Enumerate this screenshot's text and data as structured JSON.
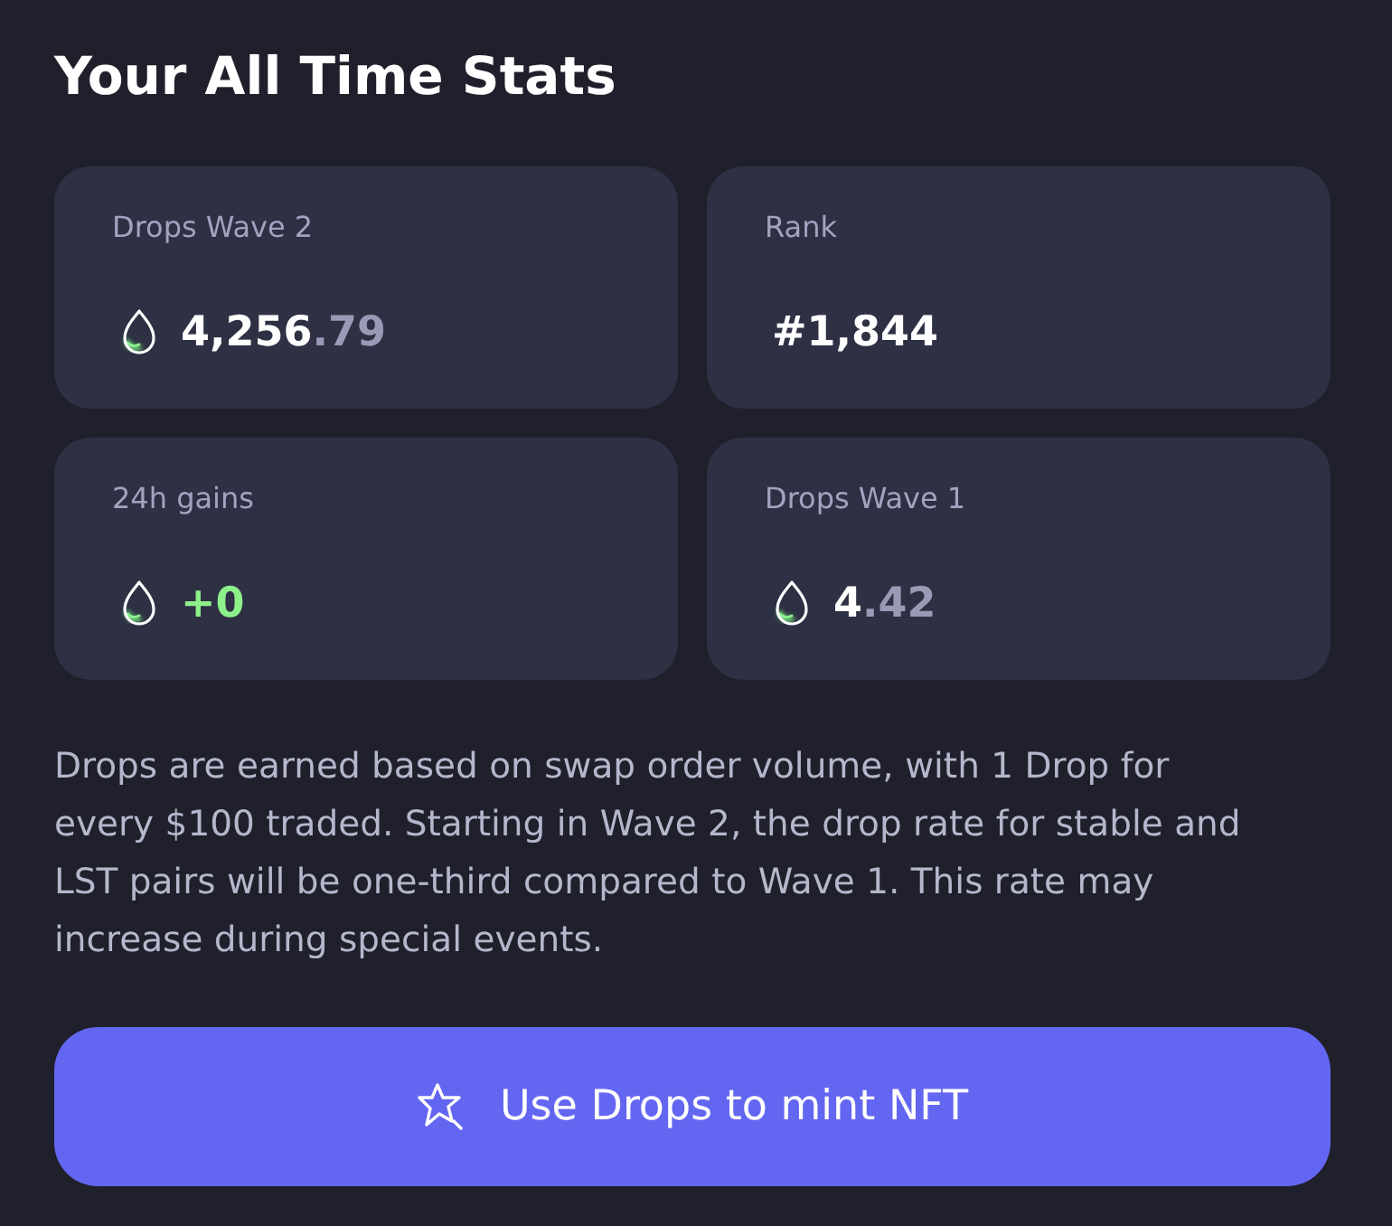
{
  "title": "Your All Time Stats",
  "stats": [
    {
      "kind": "drops",
      "label": "Drops Wave 2",
      "whole": "4,256",
      "fraction": ".79"
    },
    {
      "kind": "rank",
      "label": "Rank",
      "whole": "#1,844"
    },
    {
      "kind": "gain",
      "label": "24h gains",
      "whole": "+0"
    },
    {
      "kind": "drops",
      "label": "Drops Wave 1",
      "whole": "4",
      "fraction": ".42"
    }
  ],
  "note": "Drops are earned based on swap order volume, with 1 Drop for every $100 traded. Starting in Wave 2, the drop rate for stable and LST pairs will be one-third compared to Wave 1. This rate may increase during special events.",
  "button": {
    "label": "Use Drops to mint NFT"
  }
}
